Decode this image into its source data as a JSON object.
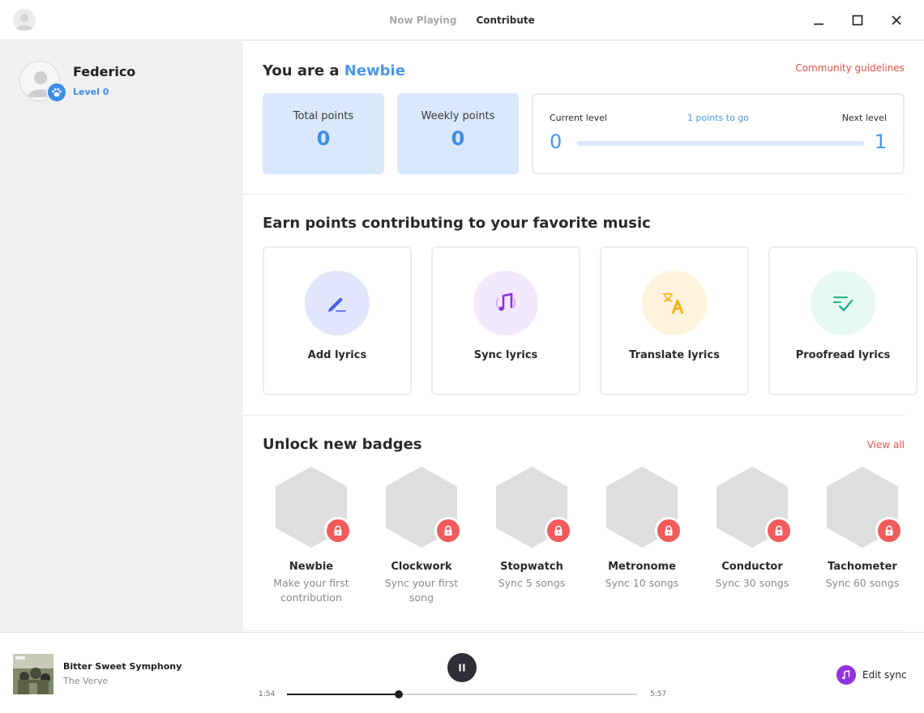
{
  "header": {
    "tabs": [
      {
        "label": "Now Playing",
        "active": false
      },
      {
        "label": "Contribute",
        "active": true
      }
    ],
    "window_controls": [
      "minimize-icon",
      "maximize-icon",
      "close-icon"
    ]
  },
  "profile": {
    "name": "Federico",
    "level_text": "Level 0",
    "badge_icon": "paw-icon"
  },
  "rank": {
    "prefix": "You are a",
    "name": "Newbie",
    "guidelines_link": "Community guidelines"
  },
  "stats": {
    "total_label": "Total points",
    "total_value": "0",
    "weekly_label": "Weekly points",
    "weekly_value": "0"
  },
  "level": {
    "current_label": "Current level",
    "next_label": "Next level",
    "to_go": "1 points to go",
    "current_value": "0",
    "next_value": "1",
    "progress_fraction": 0
  },
  "earn": {
    "title": "Earn points contributing to your favorite music",
    "cards": [
      {
        "label": "Add lyrics",
        "icon": "pencil-icon",
        "bg": "#e2e6fc",
        "color": "#4a62e8"
      },
      {
        "label": "Sync lyrics",
        "icon": "music-note-icon",
        "bg": "#f3e9fc",
        "color": "#9431e0"
      },
      {
        "label": "Translate lyrics",
        "icon": "translate-icon",
        "bg": "#fdf3dc",
        "color": "#f2b10c"
      },
      {
        "label": "Proofread lyrics",
        "icon": "proofread-check-icon",
        "bg": "#e7f8f3",
        "color": "#22b48a"
      }
    ]
  },
  "badges": {
    "title": "Unlock new badges",
    "view_all": "View all",
    "items": [
      {
        "name": "Newbie",
        "desc": "Make your first contribution"
      },
      {
        "name": "Clockwork",
        "desc": "Sync your first song"
      },
      {
        "name": "Stopwatch",
        "desc": "Sync 5 songs"
      },
      {
        "name": "Metronome",
        "desc": "Sync 10 songs"
      },
      {
        "name": "Conductor",
        "desc": "Sync 30 songs"
      },
      {
        "name": "Tachometer",
        "desc": "Sync 60 songs"
      }
    ]
  },
  "player": {
    "title": "Bitter Sweet Symphony",
    "artist": "The Verve",
    "elapsed": "1:54",
    "total": "5:57",
    "progress_fraction": 0.32,
    "edit_sync_label": "Edit sync",
    "state": "playing"
  }
}
